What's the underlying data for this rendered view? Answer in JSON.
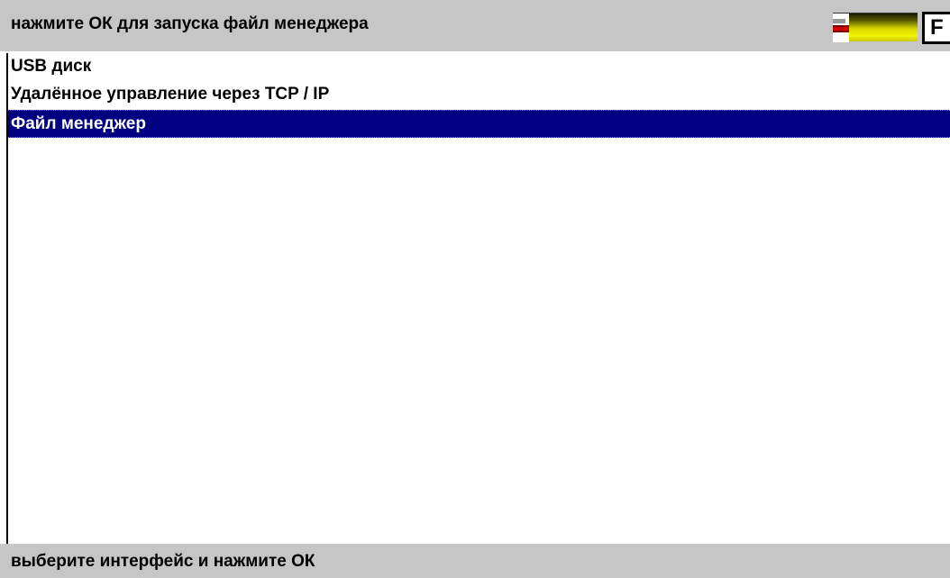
{
  "header": {
    "title": "нажмите ОК для запуска файл менеджера",
    "f_button_label": "F"
  },
  "battery": {
    "icon": "battery-icon",
    "level_color": "#f2f200",
    "alert_color": "#d40000"
  },
  "list": {
    "items": [
      {
        "label": "USB диск",
        "selected": false
      },
      {
        "label": "Удалённое управление через TCP / IP",
        "selected": false
      },
      {
        "label": "Файл менеджер",
        "selected": true
      }
    ],
    "selection_color": "#000080"
  },
  "footer": {
    "hint": "выберите интерфейс и нажмите ОК"
  }
}
